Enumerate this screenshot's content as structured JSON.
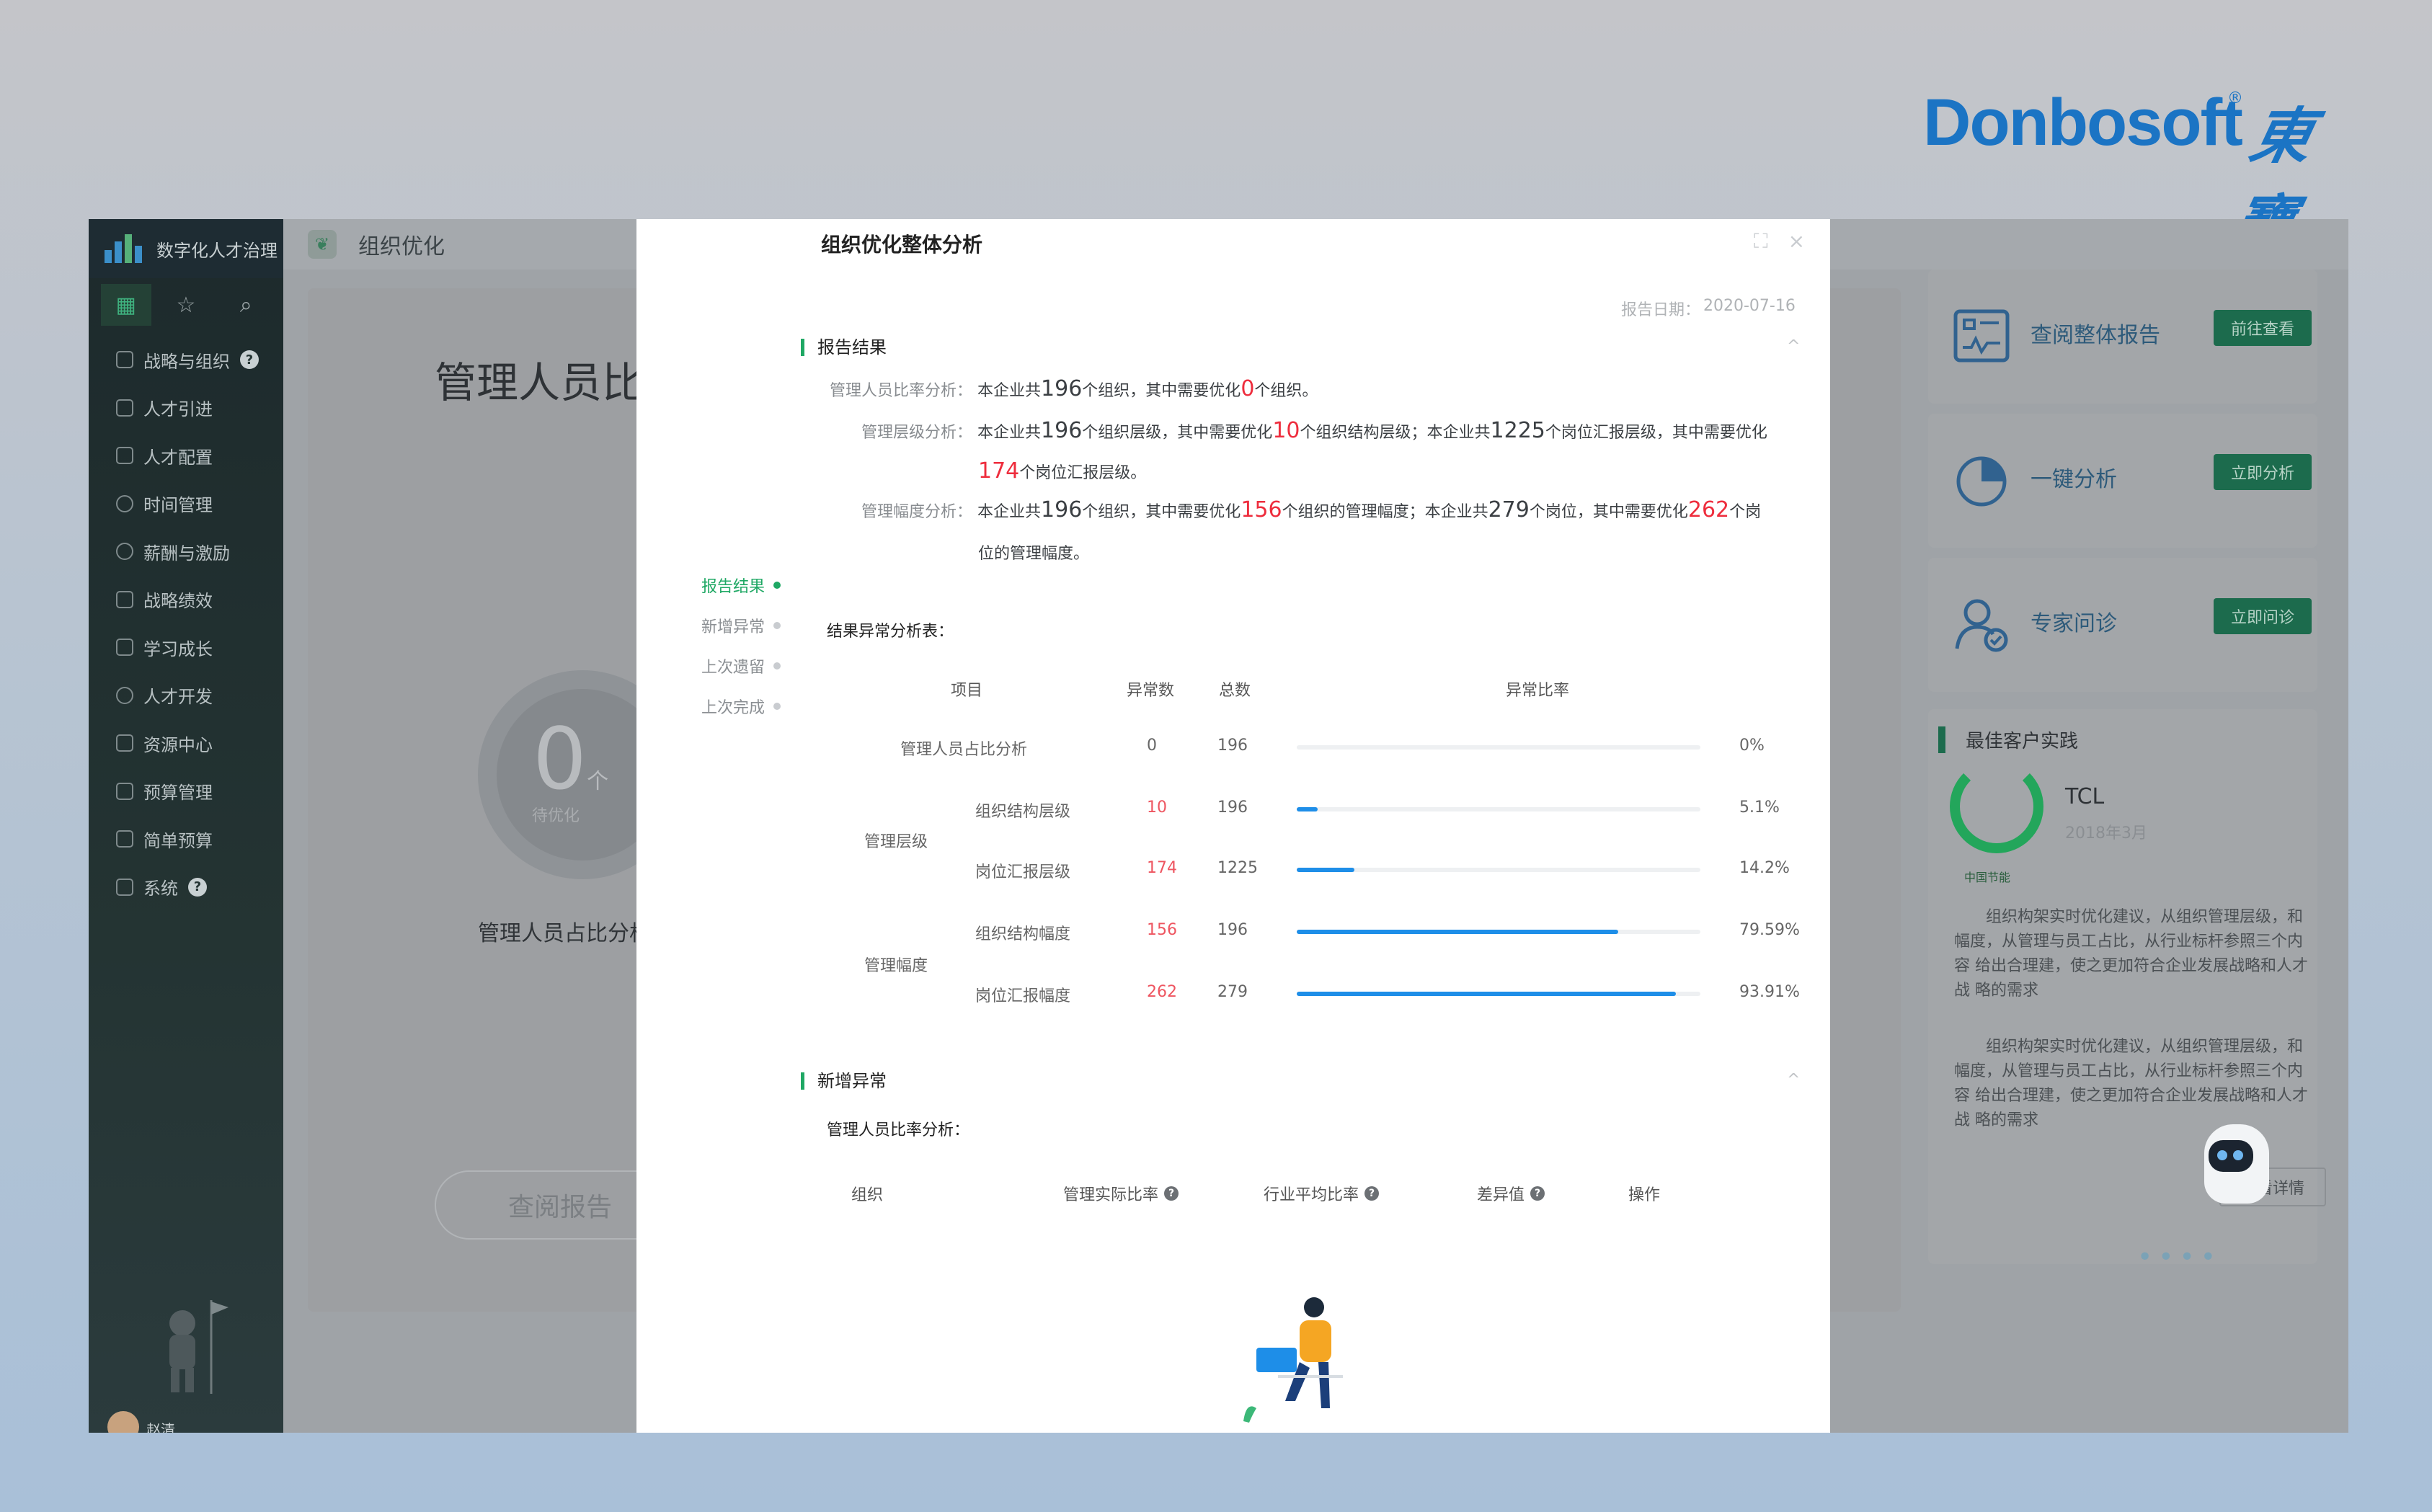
{
  "brand": {
    "name": "Donbosoft",
    "mark": "®",
    "cn": "東寶"
  },
  "sidebar": {
    "title": "数字化人才治理",
    "tools": [
      "grid-icon",
      "star-icon",
      "search-icon"
    ],
    "items": [
      {
        "label": "战略与组织",
        "help": "?"
      },
      {
        "label": "人才引进"
      },
      {
        "label": "人才配置"
      },
      {
        "label": "时间管理"
      },
      {
        "label": "薪酬与激励"
      },
      {
        "label": "战略绩效"
      },
      {
        "label": "学习成长"
      },
      {
        "label": "人才开发"
      },
      {
        "label": "资源中心"
      },
      {
        "label": "预算管理"
      },
      {
        "label": "简单预算"
      },
      {
        "label": "系统",
        "help": "?"
      }
    ],
    "user": "赵清"
  },
  "topbar": {
    "title": "组织优化"
  },
  "background": {
    "big_title": "管理人员比",
    "circle_value": "0",
    "circle_unit": "个",
    "circle_sub": "待优化",
    "label": "管理人员占比分析",
    "button": "查阅报告"
  },
  "right_panel": {
    "cards": [
      {
        "label": "查阅整体报告",
        "button": "前往查看",
        "icon": "report-icon"
      },
      {
        "label": "一键分析",
        "button": "立即分析",
        "icon": "pie-chart-icon"
      },
      {
        "label": "专家问诊",
        "button": "立即问诊",
        "icon": "expert-icon"
      }
    ],
    "best_title": "最佳客户实践",
    "customer": {
      "name": "TCL",
      "date": "2018年3月",
      "logo_caption": "中国节能"
    },
    "desc1": "组织构架实时优化建议，从组织管理层级，和幅度，从管理与员工占比，从行业标杆参照三个内容 给出合理建，使之更加符合企业发展战略和人才战 略的需求",
    "desc2": "组织构架实时优化建议，从组织管理层级，和幅度，从管理与员工占比，从行业标杆参照三个内容 给出合理建，使之更加符合企业发展战略和人才战 略的需求",
    "detail_button": "查看详情",
    "dots": "••••"
  },
  "modal": {
    "title": "组织优化整体分析",
    "controls": [
      "expand-icon",
      "close-icon"
    ],
    "date_label": "报告日期：",
    "date": "2020-07-16",
    "nav": [
      "报告结果",
      "新增异常",
      "上次遗留",
      "上次完成"
    ],
    "section1": {
      "title": "报告结果",
      "collapse": "^",
      "ratio": {
        "label": "管理人员比率分析：",
        "t1": "本企业共",
        "n1": "196",
        "t2": "个组织，其中需要优化",
        "n2": "0",
        "t3": "个组织。"
      },
      "level": {
        "label": "管理层级分析：",
        "t1": "本企业共",
        "n1": "196",
        "t2": "个组织层级，其中需要优化",
        "n2": "10",
        "t3": "个组织结构层级；本企业共",
        "n3": "1225",
        "t4": "个岗位汇报层级，其中需要优化",
        "n4": "174",
        "t5": "个岗位汇报层级。"
      },
      "width": {
        "label": "管理幅度分析：",
        "t1": "本企业共",
        "n1": "196",
        "t2": "个组织，其中需要优化",
        "n2": "156",
        "t3": "个组织的管理幅度；本企业共",
        "n3": "279",
        "t4": "个岗位，其中需要优化",
        "n4": "262",
        "t5": "个岗",
        "t6": "位的管理幅度。"
      },
      "table_title": "结果异常分析表：",
      "headers": [
        "项目",
        "异常数",
        "总数",
        "异常比率"
      ],
      "groups": [
        "管理层级",
        "管理幅度"
      ],
      "rows": [
        {
          "item": "管理人员占比分析",
          "abnormal": "0",
          "total": "196",
          "ratio": "0%",
          "fraction": 0
        },
        {
          "item": "组织结构层级",
          "abnormal": "10",
          "total": "196",
          "ratio": "5.1%",
          "fraction": 0.051
        },
        {
          "item": "岗位汇报层级",
          "abnormal": "174",
          "total": "1225",
          "ratio": "14.2%",
          "fraction": 0.142
        },
        {
          "item": "组织结构幅度",
          "abnormal": "156",
          "total": "196",
          "ratio": "79.59%",
          "fraction": 0.7959
        },
        {
          "item": "岗位汇报幅度",
          "abnormal": "262",
          "total": "279",
          "ratio": "93.91%",
          "fraction": 0.9391
        }
      ]
    },
    "section2": {
      "title": "新增异常",
      "collapse": "^",
      "sub_title": "管理人员比率分析：",
      "headers": [
        "组织",
        "管理实际比率",
        "行业平均比率",
        "差异值",
        "操作"
      ]
    }
  }
}
